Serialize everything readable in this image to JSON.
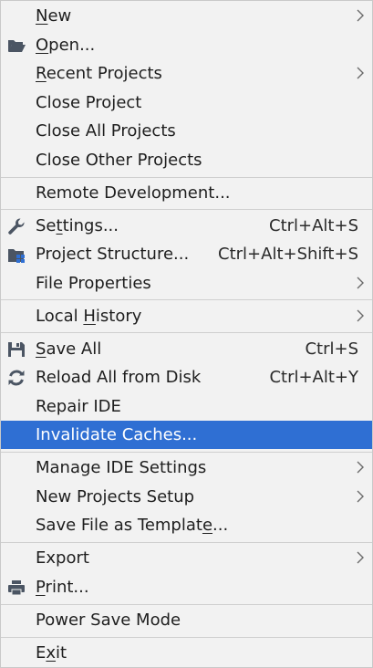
{
  "menu": {
    "items": [
      {
        "id": "new",
        "label": "New",
        "mnemonic_index": 0,
        "submenu": true,
        "icon": ""
      },
      {
        "id": "open",
        "label": "Open...",
        "mnemonic_index": 0,
        "icon": "folder-open-icon"
      },
      {
        "id": "recent-projects",
        "label": "Recent Projects",
        "mnemonic_index": 0,
        "submenu": true
      },
      {
        "id": "close-project",
        "label": "Close Project"
      },
      {
        "id": "close-all-projects",
        "label": "Close All Projects"
      },
      {
        "id": "close-other-projects",
        "label": "Close Other Projects"
      },
      {
        "id": "remote-development",
        "label": "Remote Development..."
      },
      {
        "id": "settings",
        "label": "Settings...",
        "mnemonic_index": 2,
        "shortcut": "Ctrl+Alt+S",
        "icon": "wrench-icon"
      },
      {
        "id": "project-structure",
        "label": "Project Structure...",
        "shortcut": "Ctrl+Alt+Shift+S",
        "icon": "project-structure-icon"
      },
      {
        "id": "file-properties",
        "label": "File Properties",
        "submenu": true
      },
      {
        "id": "local-history",
        "label": "Local History",
        "mnemonic_index": 6,
        "submenu": true
      },
      {
        "id": "save-all",
        "label": "Save All",
        "mnemonic_index": 0,
        "shortcut": "Ctrl+S",
        "icon": "save-icon"
      },
      {
        "id": "reload-all-from-disk",
        "label": "Reload All from Disk",
        "shortcut": "Ctrl+Alt+Y",
        "icon": "reload-icon"
      },
      {
        "id": "repair-ide",
        "label": "Repair IDE"
      },
      {
        "id": "invalidate-caches",
        "label": "Invalidate Caches...",
        "selected": true
      },
      {
        "id": "manage-ide-settings",
        "label": "Manage IDE Settings",
        "submenu": true
      },
      {
        "id": "new-projects-setup",
        "label": "New Projects Setup",
        "submenu": true
      },
      {
        "id": "save-file-as-template",
        "label": "Save File as Template...",
        "mnemonic_index": 20
      },
      {
        "id": "export",
        "label": "Export",
        "submenu": true
      },
      {
        "id": "print",
        "label": "Print...",
        "mnemonic_index": 0,
        "icon": "printer-icon"
      },
      {
        "id": "power-save-mode",
        "label": "Power Save Mode"
      },
      {
        "id": "exit",
        "label": "Exit",
        "mnemonic_index": 1
      }
    ]
  },
  "colors": {
    "background": "#f2f2f2",
    "selection": "#2f6fd3",
    "separator": "#cfcfcf",
    "icon": "#4b5563",
    "icon_accent": "#2f6fd3"
  }
}
